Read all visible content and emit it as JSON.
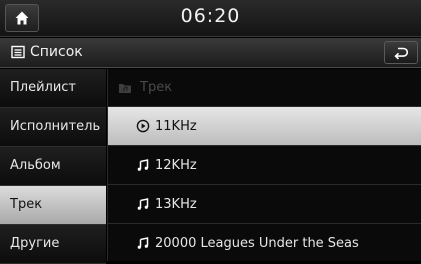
{
  "status": {
    "time": "06:20"
  },
  "header": {
    "title": "Список"
  },
  "categories": [
    {
      "label": "Плейлист",
      "active": false
    },
    {
      "label": "Исполнитель",
      "active": false
    },
    {
      "label": "Альбом",
      "active": false
    },
    {
      "label": "Трек",
      "active": true
    },
    {
      "label": "Другие",
      "active": false
    }
  ],
  "list": {
    "folder_label": "Трек",
    "items": [
      {
        "label": "11KHz",
        "icon": "play-circle-icon",
        "selected": true
      },
      {
        "label": "12KHz",
        "icon": "music-note-icon",
        "selected": false
      },
      {
        "label": "13KHz",
        "icon": "music-note-icon",
        "selected": false
      },
      {
        "label": "20000 Leagues Under the Seas",
        "icon": "music-note-icon",
        "selected": false
      }
    ]
  },
  "colors": {
    "selection": "#d4d4d4",
    "background": "#000000",
    "text": "#ffffff",
    "dim_text": "#4a4a4a"
  }
}
